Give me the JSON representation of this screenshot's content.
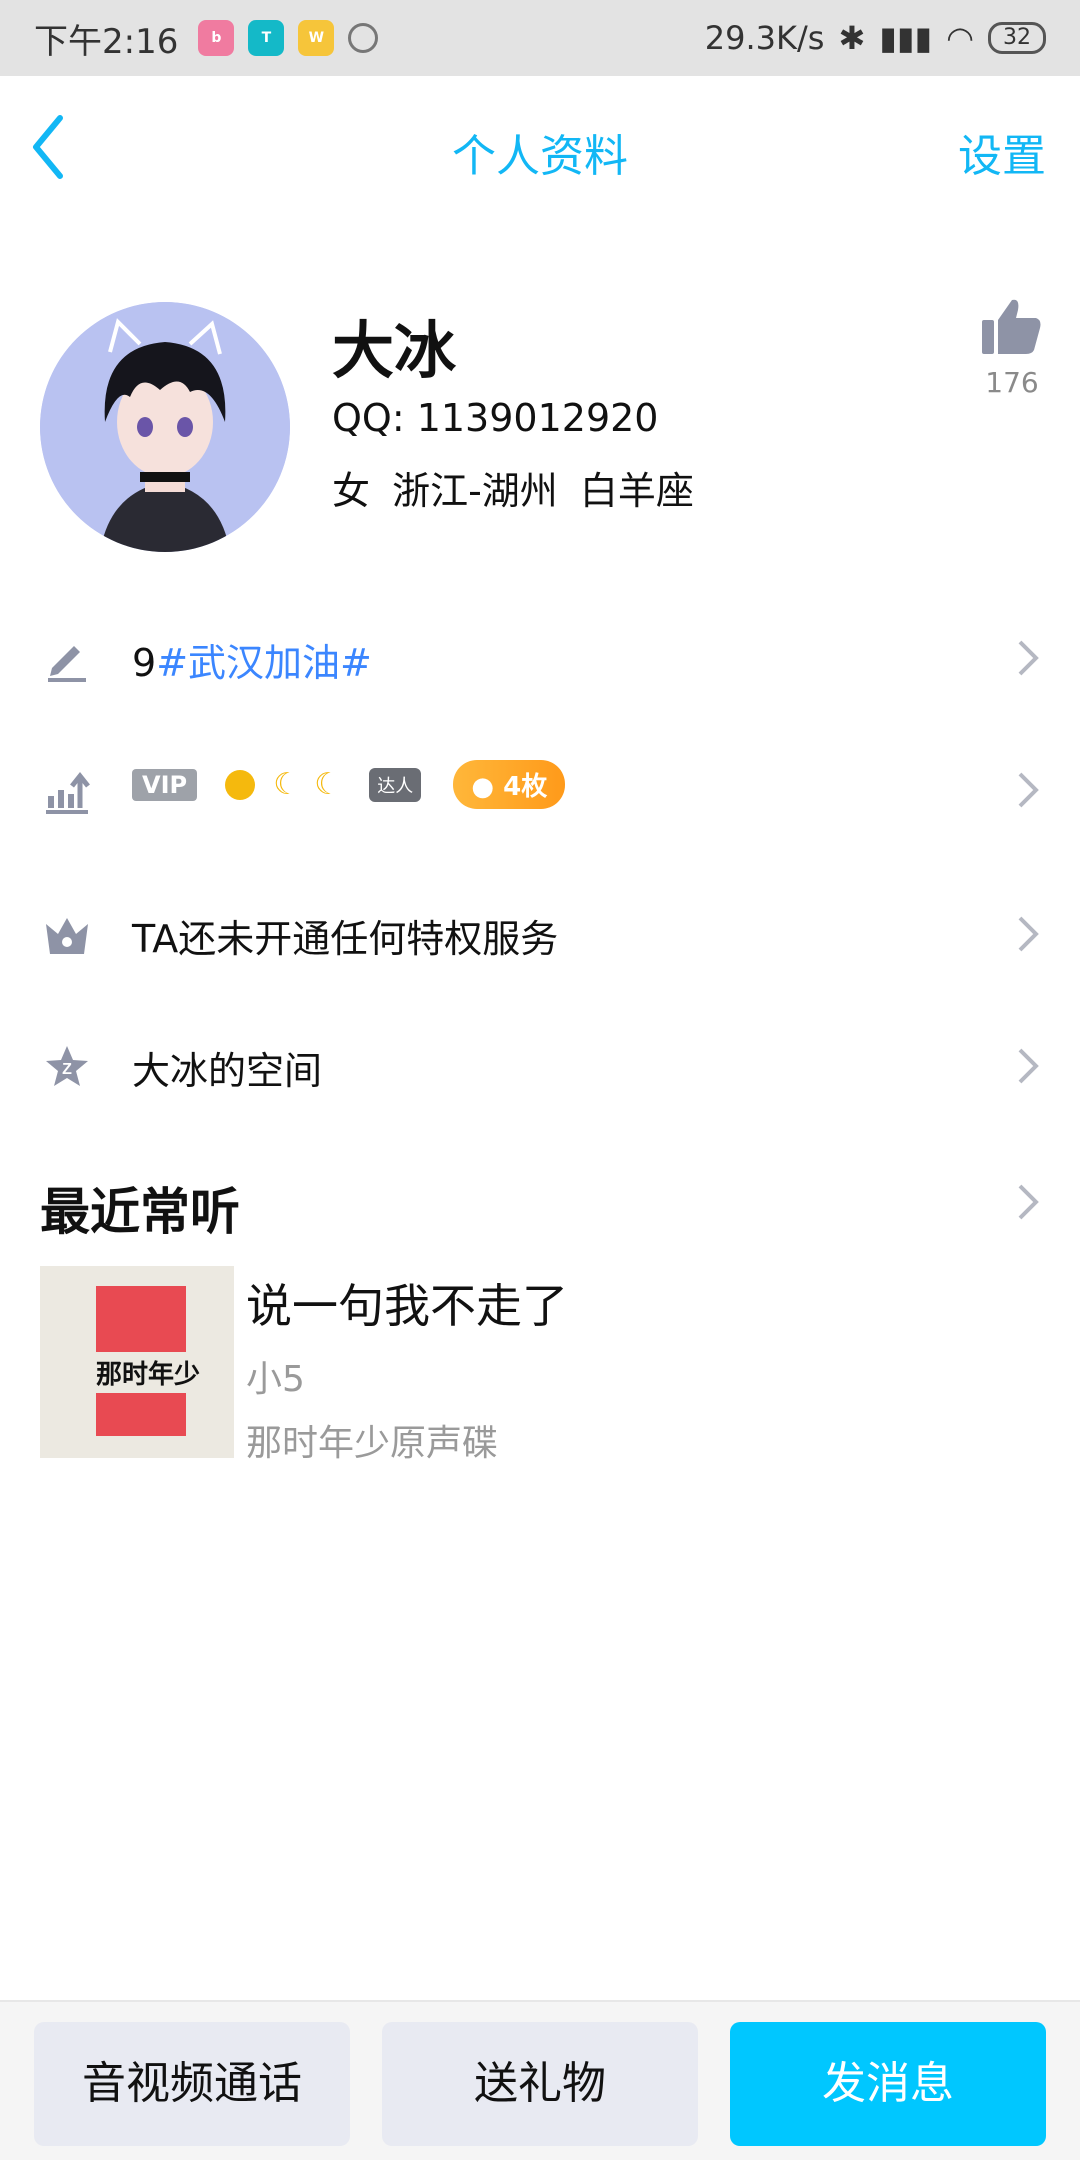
{
  "status_bar": {
    "time": "下午2:16",
    "network_speed": "29.3K/s",
    "battery": "32",
    "app_icons": [
      "bilibili-icon",
      "taptap-icon",
      "weibo-icon",
      "timer-icon"
    ]
  },
  "nav": {
    "title": "个人资料",
    "settings": "设置"
  },
  "profile": {
    "name": "大冰",
    "qq": "QQ: 1139012920",
    "info": "女  浙江-湖州  白羊座",
    "like_count": "176"
  },
  "rows": {
    "signature_prefix": "9",
    "signature_tag": "#武汉加油#",
    "vip_label": "VIP",
    "daren_label": "达人",
    "medals_label": "4枚",
    "privilege": "TA还未开通任何特权服务",
    "space": "大冰的空间"
  },
  "music": {
    "section_title": "最近常听",
    "song_title": "说一句我不走了",
    "artist": "小5",
    "album": "那时年少原声碟",
    "album_cover_text": "那时年少"
  },
  "bottom_buttons": {
    "call": "音视频通话",
    "gift": "送礼物",
    "message": "发消息"
  },
  "colors": {
    "accent": "#12b7f5",
    "hashtag": "#3b86ff",
    "primary_button": "#00c7ff",
    "secondary_button": "#e8eaf2",
    "icon_gray": "#8e93a6"
  }
}
